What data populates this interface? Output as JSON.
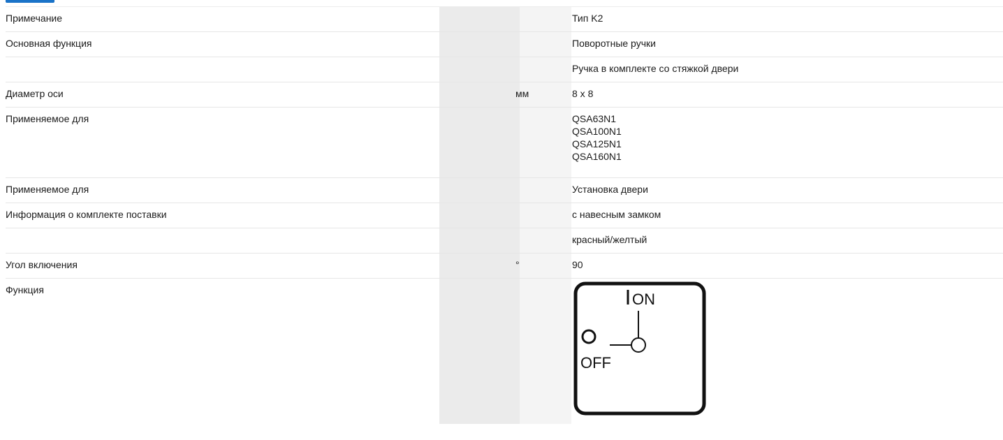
{
  "rows": [
    {
      "label": "Примечание",
      "unit": "",
      "values": [
        "Тип K2"
      ]
    },
    {
      "label": "Основная функция",
      "unit": "",
      "values": [
        "Поворотные ручки"
      ]
    },
    {
      "label": "",
      "unit": "",
      "values": [
        "Ручка в комплекте со стяжкой двери"
      ]
    },
    {
      "label": "Диаметр оси",
      "unit": "мм",
      "values": [
        "8 x 8"
      ]
    },
    {
      "label": "Применяемое для",
      "unit": "",
      "values": [
        "QSA63N1",
        "QSA100N1",
        "QSA125N1",
        "QSA160N1"
      ]
    },
    {
      "label": "Применяемое для",
      "unit": "",
      "values": [
        "Установка двери"
      ]
    },
    {
      "label": "Информация о комплекте поставки",
      "unit": "",
      "values": [
        "с навесным замком"
      ]
    },
    {
      "label": "",
      "unit": "",
      "values": [
        "красный/желтый"
      ]
    },
    {
      "label": "Угол включения",
      "unit": "°",
      "values": [
        "90"
      ]
    },
    {
      "label": "Функция",
      "unit": "",
      "values": []
    }
  ],
  "function_diagram": {
    "on_label": "ON",
    "off_label": "OFF",
    "on_mark": "I"
  },
  "colors": {
    "accent": "#1a73c8",
    "shade_column": "#ebebeb",
    "unit_column": "#f4f4f4",
    "divider": "#e6e6e6"
  }
}
